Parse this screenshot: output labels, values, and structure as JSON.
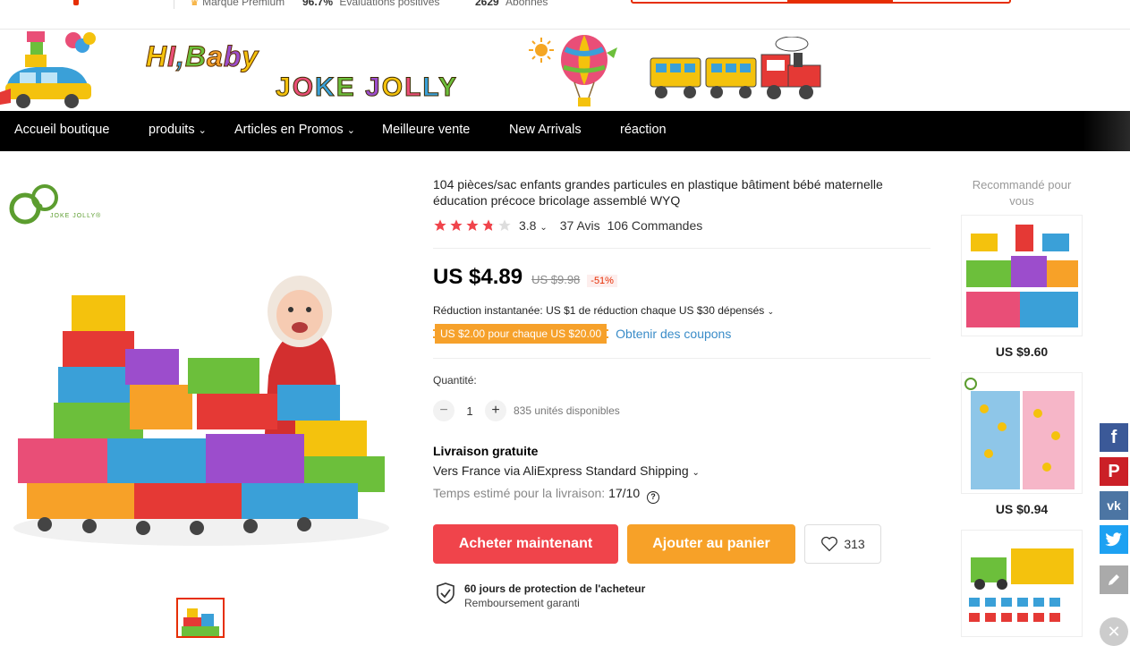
{
  "topbar": {
    "premium": "Marque Premium",
    "rating_pct": "96.7%",
    "rating_label": "Évaluations positives",
    "followers": "2629",
    "followers_label": "Abonnés"
  },
  "banner": {
    "hi_baby": "HI,Baby",
    "joke_jolly": "JOKE JOLLY"
  },
  "nav": {
    "items": [
      {
        "label": "Accueil boutique"
      },
      {
        "label": "produits"
      },
      {
        "label": "Articles en Promos"
      },
      {
        "label": "Meilleure vente"
      },
      {
        "label": "New Arrivals"
      },
      {
        "label": "réaction"
      }
    ]
  },
  "brand": {
    "logo_text": "JOKE JOLLY®"
  },
  "product": {
    "title": "104 pièces/sac enfants grandes particules en plastique bâtiment bébé maternelle éducation précoce bricolage assemblé WYQ",
    "rating": 3.8,
    "rating_text": "3.8",
    "reviews": "37 Avis",
    "orders": "106 Commandes",
    "price": "US $4.89",
    "old_price": "US $9.98",
    "discount": "-51%",
    "instant_discount": "Réduction instantanée: US $1 de réduction chaque US $30 dépensés",
    "coupon": "US $2.00 pour chaque US $20.00",
    "coupon_link": "Obtenir des coupons",
    "quantity_label": "Quantité:",
    "quantity": "1",
    "available": "835 unités disponibles",
    "shipping_title": "Livraison gratuite",
    "shipping_via": "Vers France via AliExpress Standard Shipping",
    "delivery_label": "Temps estimé pour la livraison:",
    "delivery_date": "17/10",
    "buy_now": "Acheter maintenant",
    "add_to_cart": "Ajouter au panier",
    "wishlist_count": "313",
    "protection_title": "60 jours de protection de l'acheteur",
    "protection_sub": "Remboursement garanti"
  },
  "recommended": {
    "title": "Recommandé pour vous",
    "items": [
      {
        "price": "US $9.60"
      },
      {
        "price": "US $0.94"
      }
    ]
  },
  "colors": {
    "accent_red": "#f0444b",
    "accent_orange": "#f7a128",
    "nav_bg": "#000000",
    "link_blue": "#3a8cc8",
    "facebook": "#3b5998",
    "pinterest": "#cb2027",
    "vk": "#4c75a3",
    "twitter": "#1da1f2"
  },
  "social": [
    "facebook-icon",
    "pinterest-icon",
    "vk-icon",
    "twitter-icon",
    "edit-icon",
    "close-icon"
  ]
}
